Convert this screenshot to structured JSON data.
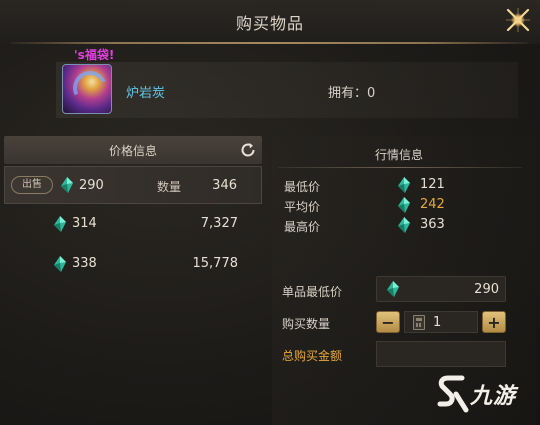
{
  "window": {
    "title": "购买物品"
  },
  "item": {
    "tag": "'s福袋!",
    "name": "炉岩炭",
    "owned_label": "拥有",
    "owned_value": "0",
    "owned_text": "拥有：0"
  },
  "price_panel": {
    "header": "价格信息",
    "listings": [
      {
        "sell_button": "出售",
        "price": "290",
        "qty_label": "数量",
        "qty": "346"
      },
      {
        "price": "314",
        "qty": "7,327"
      },
      {
        "price": "338",
        "qty": "15,778"
      }
    ]
  },
  "market_panel": {
    "header": "行情信息",
    "rows": [
      {
        "label": "最低价",
        "value": "121",
        "color": "#e6e0d4"
      },
      {
        "label": "平均价",
        "value": "242",
        "color": "#e6a93a"
      },
      {
        "label": "最高价",
        "value": "363",
        "color": "#e6e0d4"
      }
    ]
  },
  "purchase": {
    "unit_price_label": "单品最低价",
    "unit_price_value": "290",
    "quantity_label": "购买数量",
    "quantity_value": "1",
    "minus_label": "−",
    "plus_label": "+",
    "total_label": "总购买金额"
  },
  "watermark": {
    "text": "九游"
  },
  "colors": {
    "gem": "#3fd2b0",
    "accent_gold": "#e6a93a",
    "item_name": "#62c7e6",
    "tag_magenta": "#e23ee0"
  }
}
